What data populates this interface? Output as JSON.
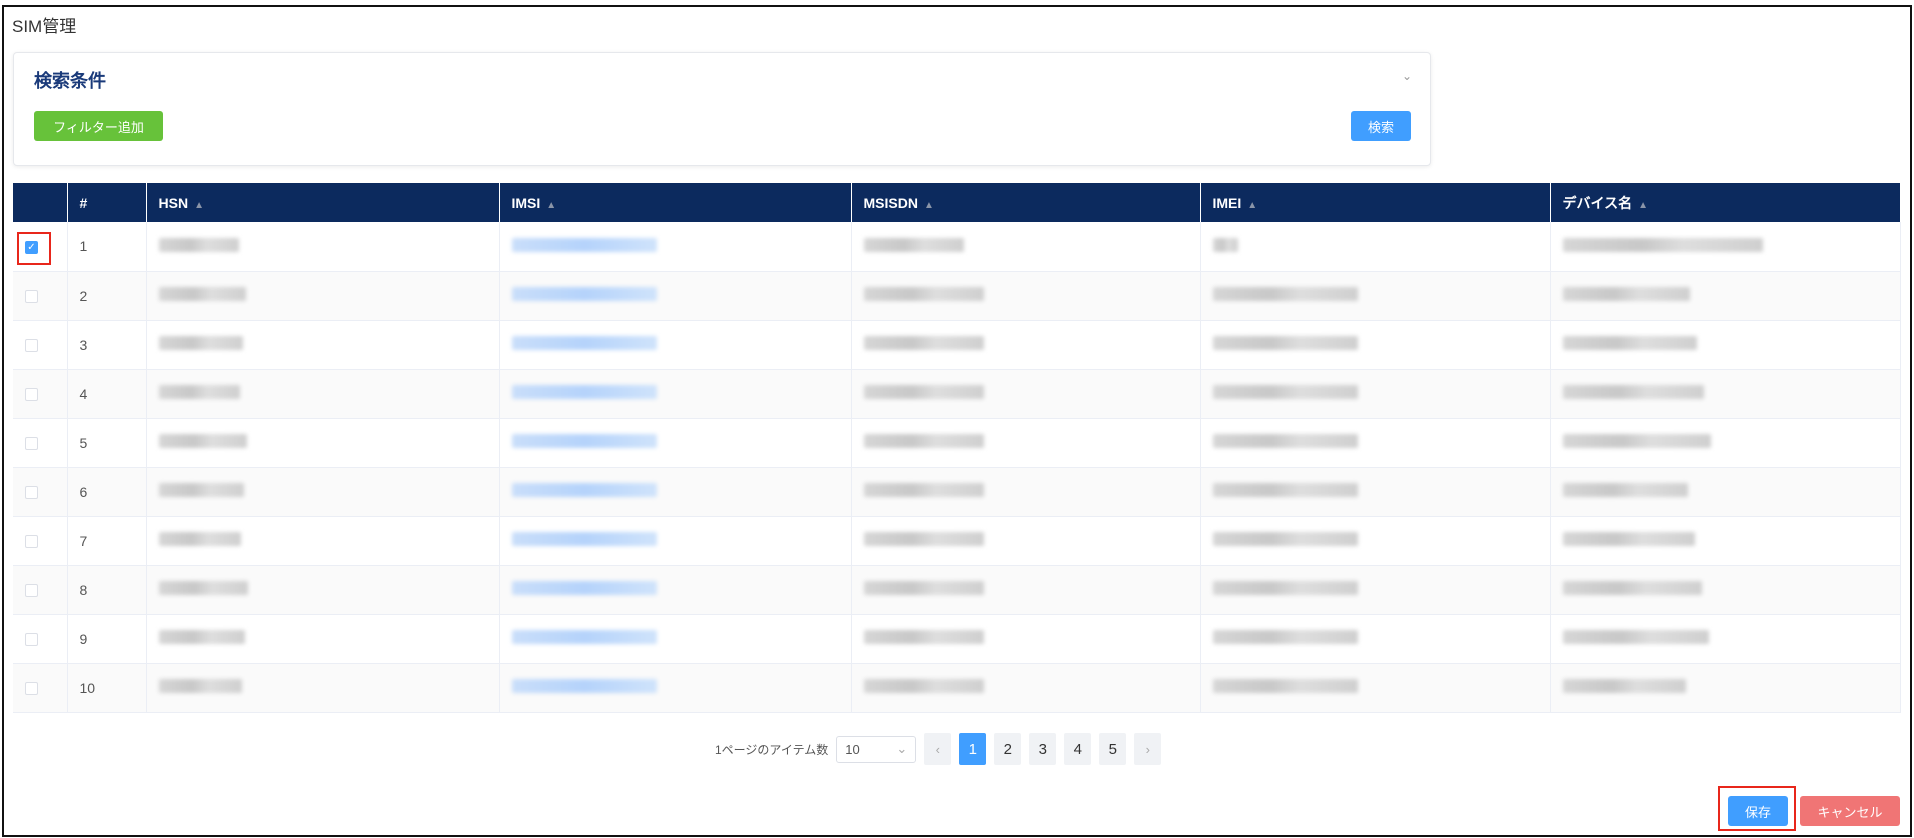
{
  "page": {
    "title": "SIM管理"
  },
  "search": {
    "title": "検索条件",
    "add_filter": "フィルター追加",
    "search_button": "検索"
  },
  "table": {
    "columns": [
      "#",
      "HSN",
      "IMSI",
      "MSISDN",
      "IMEI",
      "デバイス名"
    ],
    "rows": [
      {
        "n": "1",
        "checked": true
      },
      {
        "n": "2"
      },
      {
        "n": "3"
      },
      {
        "n": "4"
      },
      {
        "n": "5"
      },
      {
        "n": "6"
      },
      {
        "n": "7"
      },
      {
        "n": "8"
      },
      {
        "n": "9"
      },
      {
        "n": "10"
      }
    ]
  },
  "pagination": {
    "per_page_label": "1ページのアイテム数",
    "per_page": "10",
    "pages": [
      "1",
      "2",
      "3",
      "4",
      "5"
    ],
    "current": "1"
  },
  "actions": {
    "save": "保存",
    "cancel": "キャンセル"
  },
  "colors": {
    "header": "#0c2a5e",
    "primary": "#409eff",
    "success": "#67c23a",
    "danger": "#f07575"
  }
}
